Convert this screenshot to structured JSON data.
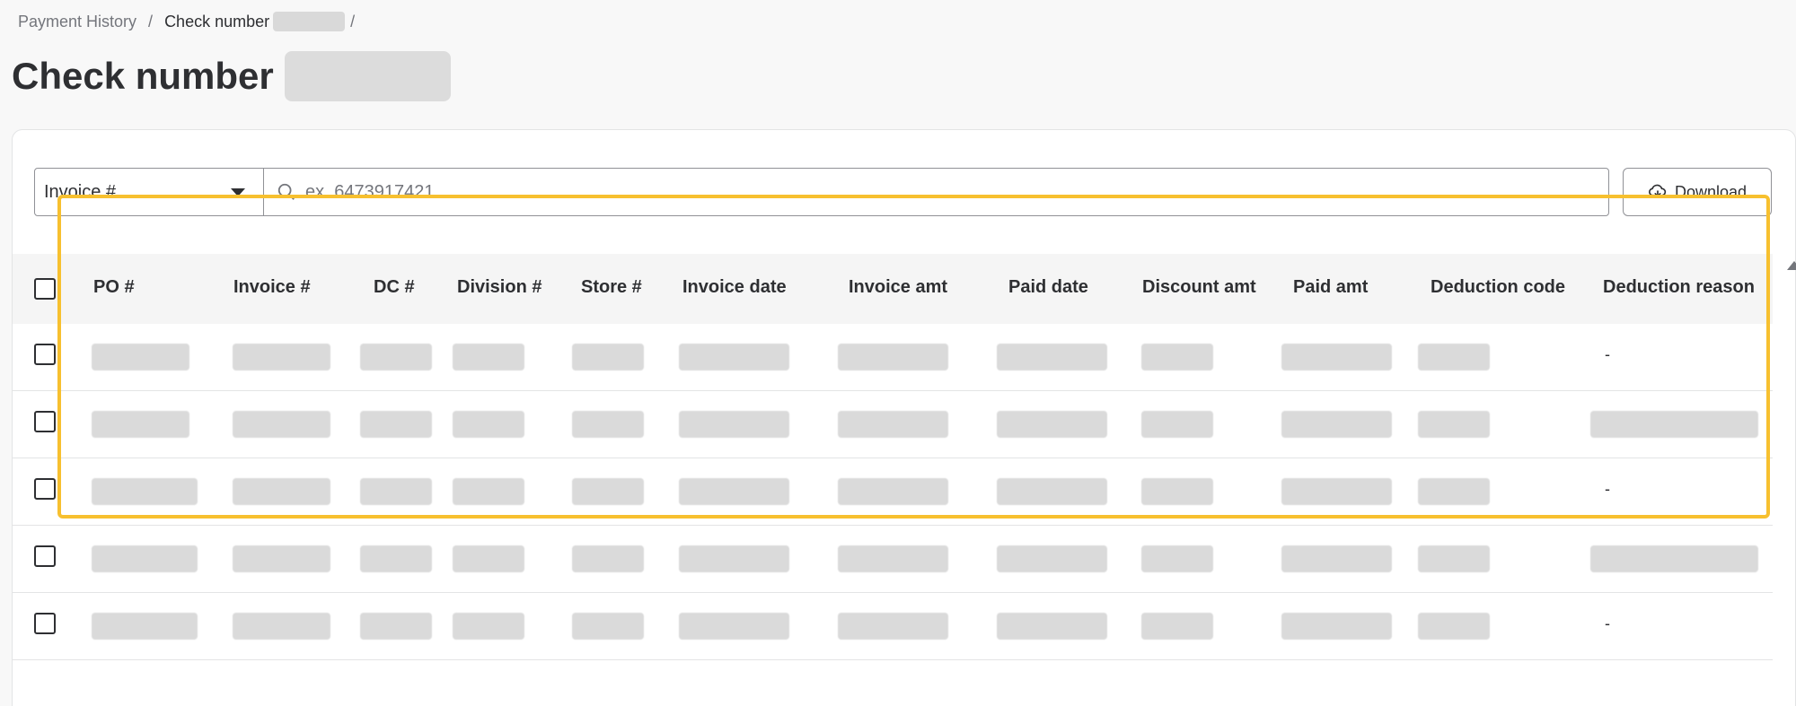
{
  "breadcrumb": {
    "items": [
      "Payment History",
      "Check number"
    ],
    "separator": "/"
  },
  "page": {
    "title": "Check number"
  },
  "filter": {
    "selected": "Invoice #",
    "search_placeholder": "ex. 6473917421",
    "download_label": "Download"
  },
  "table": {
    "columns": [
      "PO #",
      "Invoice #",
      "DC #",
      "Division #",
      "Store #",
      "Invoice date",
      "Invoice amt",
      "Paid date",
      "Discount amt",
      "Paid amt",
      "Deduction code",
      "Deduction reason"
    ],
    "rows": [
      {
        "deduction_reason": "-"
      },
      {
        "deduction_reason": ""
      },
      {
        "deduction_reason": "-"
      },
      {
        "deduction_reason": ""
      },
      {
        "deduction_reason": "-"
      }
    ]
  },
  "colors": {
    "highlight": "#f7c02f",
    "text": "#2e2f32",
    "muted": "#74767c"
  },
  "icons": {
    "search": "search-icon",
    "download": "cloud-download-icon",
    "dropdown": "caret-down-icon"
  }
}
